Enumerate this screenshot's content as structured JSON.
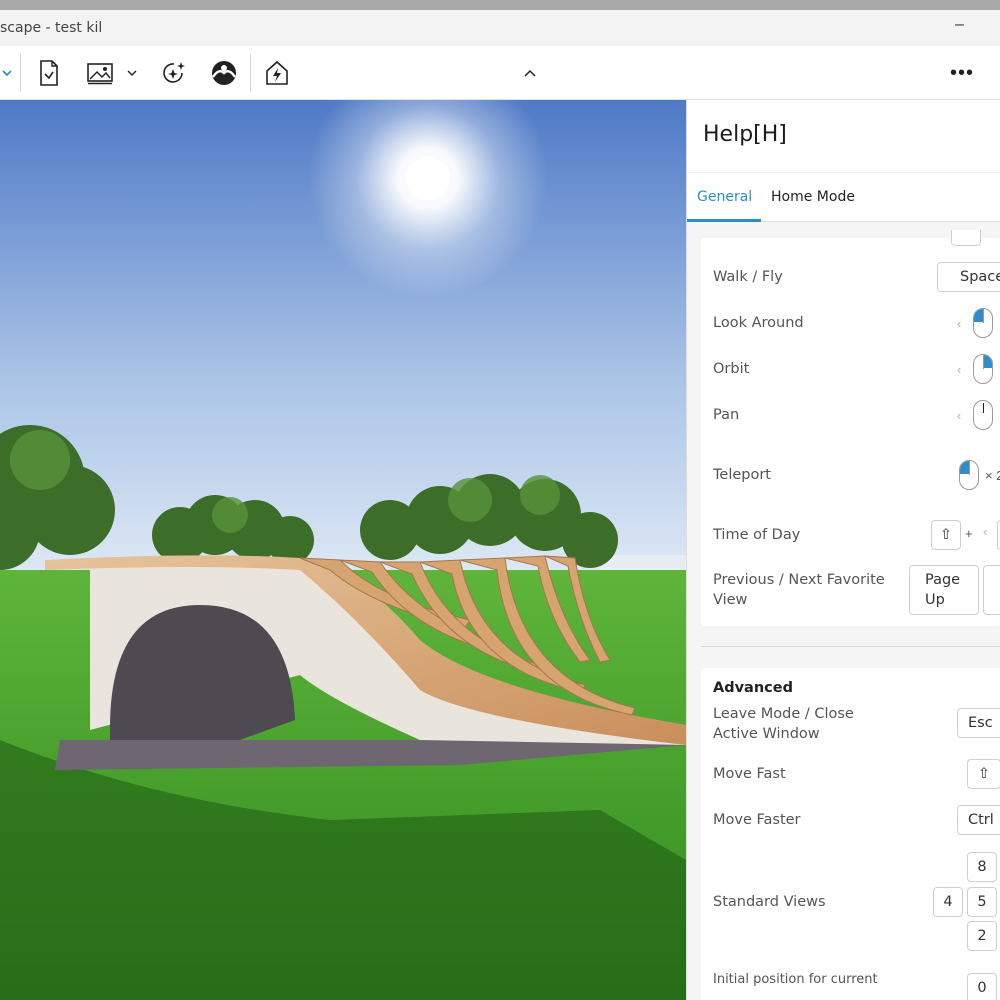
{
  "window": {
    "title": "scape - test kil",
    "minimize_glyph": "–"
  },
  "toolbar": {
    "icons": [
      "export-icon",
      "image-icon",
      "chevron-down-icon",
      "sparkle-icon",
      "sky-icon",
      "lightning-house-icon",
      "chevron-up-icon",
      "more-icon"
    ],
    "more_label": "•••",
    "collapse_label": "^"
  },
  "panel": {
    "title": "Help[H]",
    "tabs": [
      {
        "label": "General",
        "active": true
      },
      {
        "label": "Home Mode",
        "active": false
      }
    ],
    "general": {
      "rows": {
        "walk_fly": {
          "label": "Walk / Fly",
          "key": "Space"
        },
        "look_around": {
          "label": "Look Around"
        },
        "orbit": {
          "label": "Orbit"
        },
        "pan": {
          "label": "Pan"
        },
        "teleport": {
          "label": "Teleport",
          "suffix": "× 2"
        },
        "time_of_day": {
          "label": "Time of Day",
          "plus": "+",
          "key": "⇧"
        },
        "favorite": {
          "label_line1": "Previous / Next Favorite",
          "label_line2": "View",
          "key_line1": "Page",
          "key_line2": "Up"
        }
      }
    },
    "advanced": {
      "title": "Advanced",
      "rows": {
        "leave_mode": {
          "label_line1": "Leave Mode / Close",
          "label_line2": "Active Window",
          "key": "Esc"
        },
        "move_fast": {
          "label": "Move Fast",
          "key": "⇧"
        },
        "move_faster": {
          "label": "Move Faster",
          "key": "Ctrl"
        },
        "standard_views": {
          "label": "Standard Views",
          "keys": [
            "8",
            "4",
            "5",
            "2"
          ]
        },
        "initial_position": {
          "label": "Initial position for current",
          "key": "0"
        }
      }
    }
  },
  "colors": {
    "accent": "#2d8cc9",
    "sky_top": "#5a86d0",
    "grass": "#3f9a2a",
    "wood": "#d9a878"
  }
}
